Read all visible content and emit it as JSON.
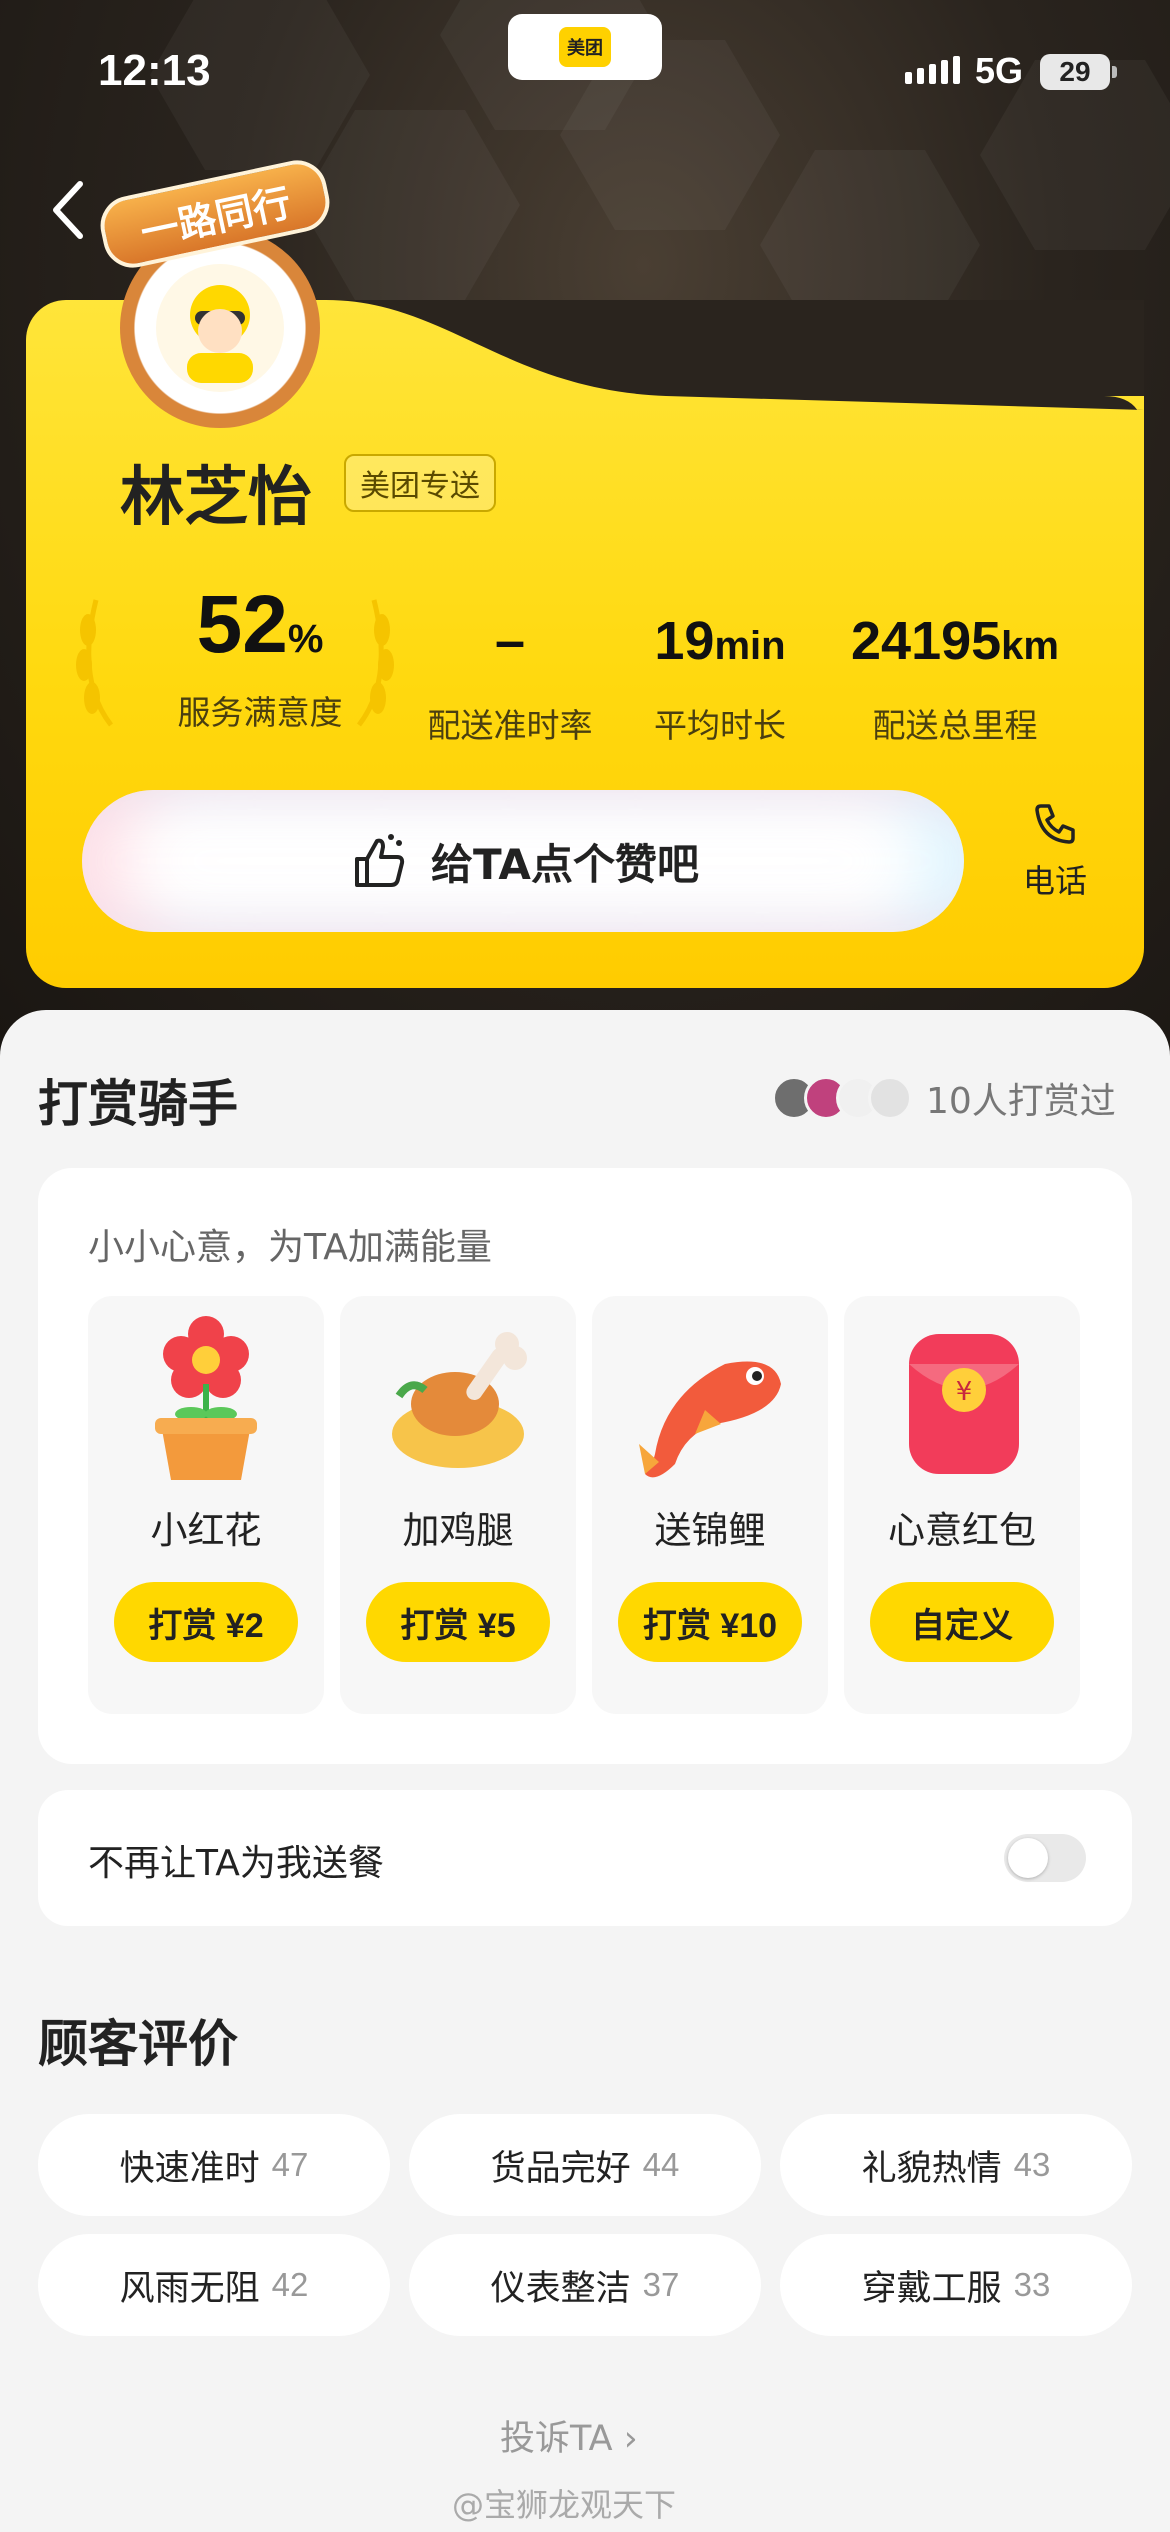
{
  "status": {
    "time": "12:13",
    "network": "5G",
    "battery": "29"
  },
  "app": {
    "logo_text": "美团",
    "name": "美团"
  },
  "rider": {
    "badge": "一路同行",
    "name": "林芝怡",
    "tag": "美团专送",
    "stats": [
      {
        "value": "52",
        "unit": "%",
        "label": "服务满意度"
      },
      {
        "value": "–",
        "unit": "",
        "label": "配送准时率"
      },
      {
        "value": "19",
        "unit": "min",
        "label": "平均时长"
      },
      {
        "value": "24195",
        "unit": "km",
        "label": "配送总里程"
      }
    ],
    "like_label": "给TA点个赞吧",
    "phone_label": "电话"
  },
  "tip": {
    "title": "打赏骑手",
    "tippers_label": "10人打赏过",
    "subtitle": "小小心意，为TA加满能量",
    "gifts": [
      {
        "name": "小红花",
        "button": "打赏 ¥2",
        "icon": "flower-icon"
      },
      {
        "name": "加鸡腿",
        "button": "打赏 ¥5",
        "icon": "drumstick-icon"
      },
      {
        "name": "送锦鲤",
        "button": "打赏 ¥10",
        "icon": "koi-icon"
      },
      {
        "name": "心意红包",
        "button": "自定义",
        "icon": "red-envelope-icon"
      }
    ]
  },
  "block": {
    "label": "不再让TA为我送餐",
    "enabled": false
  },
  "reviews": {
    "title": "顾客评价",
    "tags": [
      {
        "label": "快速准时",
        "count": "47"
      },
      {
        "label": "货品完好",
        "count": "44"
      },
      {
        "label": "礼貌热情",
        "count": "43"
      },
      {
        "label": "风雨无阻",
        "count": "42"
      },
      {
        "label": "仪表整洁",
        "count": "37"
      },
      {
        "label": "穿戴工服",
        "count": "33"
      }
    ]
  },
  "complain_label": "投诉TA ›",
  "watermark": "@宝狮龙观天下",
  "colors": {
    "accent_yellow": "#ffd800",
    "card_yellow": "#ffe53a",
    "dark_bg": "#2a241e"
  }
}
